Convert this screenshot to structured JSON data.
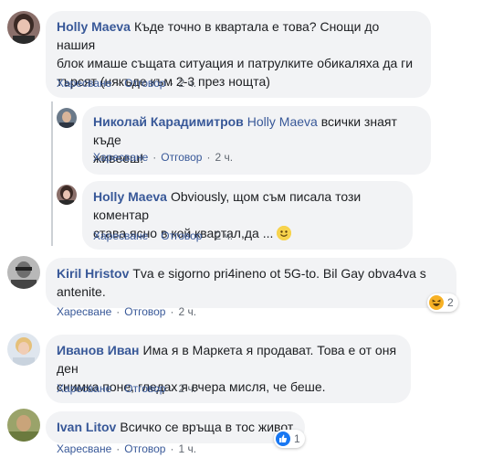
{
  "actions": {
    "like": "Харесване",
    "reply": "Отговор",
    "sep": "·"
  },
  "comments": [
    {
      "author": "Holly Maeva",
      "text_lines": [
        "Къде точно в квартала е това? Снощи до нашия",
        "блок имаше същата ситуация и патрулките обикаляха да ги",
        "търсят (някъде към 2-3 през нощта)"
      ],
      "time": "2 ч.",
      "replies": [
        {
          "author": "Николай Карадимитров",
          "mention": "Holly Maeva",
          "text_lines": [
            "всички знаят къде",
            "живееш!"
          ],
          "time": "2 ч."
        },
        {
          "author": "Holly Maeva",
          "text_lines": [
            "Obviously, щом съм писала този коментар",
            "става ясно в кой квартал,да ..."
          ],
          "emoji": "smile-emoji",
          "time": "2 ч."
        }
      ]
    },
    {
      "author": "Kiril Hristov",
      "text_lines": [
        "Tva e sigorno pri4ineno ot 5G-to. Bil Gay obva4va s",
        "antenite."
      ],
      "time": "2 ч.",
      "reaction": {
        "type": "haha",
        "count": "2"
      }
    },
    {
      "author": "Иванов Иван",
      "text_lines": [
        "Има я в Маркета я продават. Това е от оня ден",
        "снимка поне, гледах я вчера мисля, че беше."
      ],
      "time": "2 ч."
    },
    {
      "author": "Ivan Litov",
      "text_lines": [
        "Всичко се връща в тос живот"
      ],
      "time": "1 ч.",
      "reaction": {
        "type": "like",
        "count": "1"
      }
    }
  ],
  "colors": {
    "link": "#385898",
    "bubble": "#f2f3f5",
    "meta": "#606770",
    "haha": "#f7b125",
    "like": "#1877f2"
  }
}
